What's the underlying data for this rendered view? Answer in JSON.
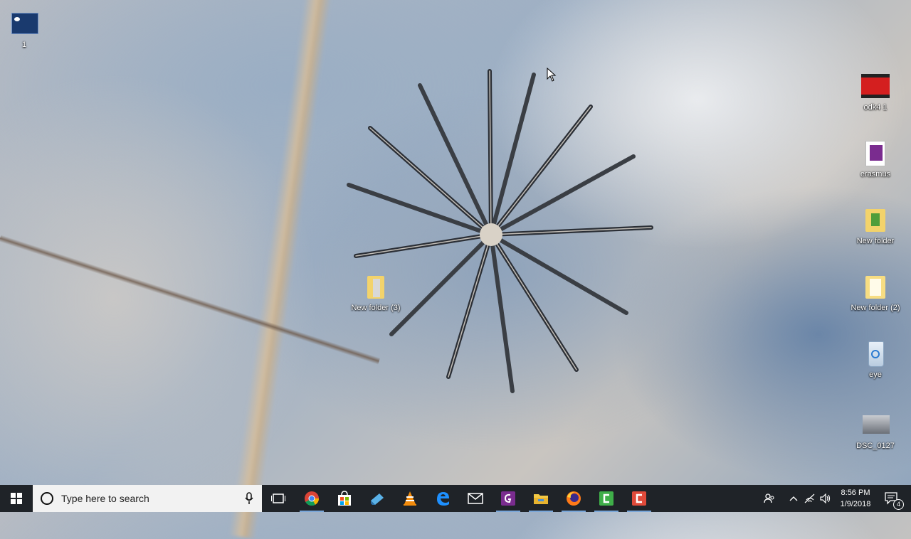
{
  "desktop": {
    "icons": [
      {
        "label": "1"
      },
      {
        "label": "odk4 1"
      },
      {
        "label": "erasmus"
      },
      {
        "label": "New folder"
      },
      {
        "label": "New folder (2)"
      },
      {
        "label": "eye"
      },
      {
        "label": "DSC_0127"
      },
      {
        "label": "New folder (3)"
      }
    ]
  },
  "taskbar": {
    "search_placeholder": "Type here to search",
    "apps": [
      {
        "icon": "task-view-icon"
      },
      {
        "icon": "chrome-icon"
      },
      {
        "icon": "store-icon"
      },
      {
        "icon": "app-blue-icon"
      },
      {
        "icon": "vlc-icon"
      },
      {
        "icon": "edge-icon"
      },
      {
        "icon": "mail-icon"
      },
      {
        "icon": "pdf-app-icon"
      },
      {
        "icon": "file-explorer-icon"
      },
      {
        "icon": "firefox-icon"
      },
      {
        "icon": "camtasia-green-icon"
      },
      {
        "icon": "camtasia-red-icon"
      }
    ],
    "clock": {
      "time": "8:56 PM",
      "date": "1/9/2018"
    },
    "notifications_count": "4"
  },
  "colors": {
    "taskbar": "#1f2328",
    "search_bg": "#f2f2f2",
    "active_indicator": "#7aa7d9"
  }
}
